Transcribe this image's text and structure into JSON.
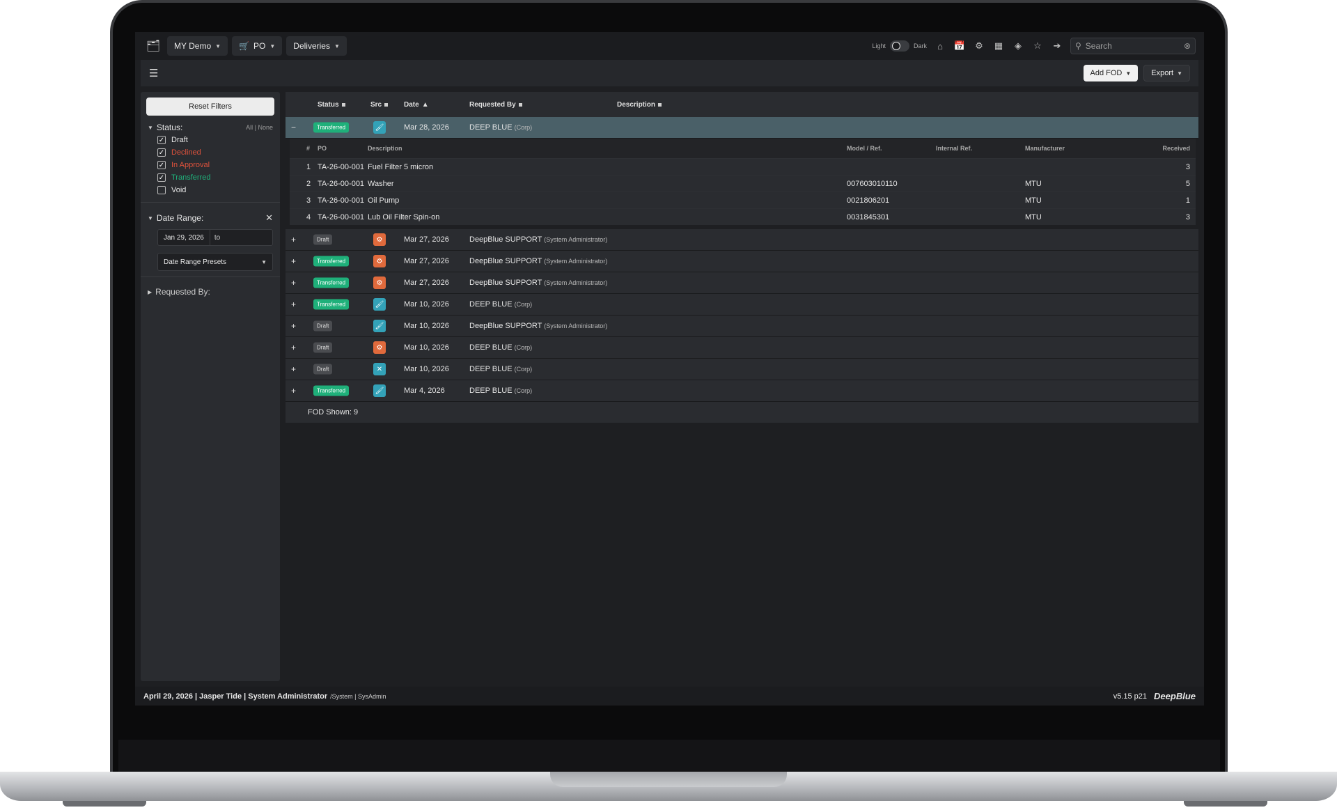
{
  "nav": {
    "menus": [
      {
        "label": "MY Demo"
      },
      {
        "label": "PO"
      },
      {
        "label": "Deliveries"
      }
    ],
    "theme_light": "Light",
    "theme_dark": "Dark",
    "search_placeholder": "Search"
  },
  "toolbar": {
    "add_label": "Add FOD",
    "export_label": "Export"
  },
  "sidebar": {
    "reset_label": "Reset Filters",
    "status_title": "Status:",
    "all_none": "All | None",
    "statuses": [
      {
        "label": "Draft",
        "checked": true,
        "color": "#e6e6e6"
      },
      {
        "label": "Declined",
        "checked": true,
        "color": "#e0523c"
      },
      {
        "label": "In Approval",
        "checked": true,
        "color": "#e0523c"
      },
      {
        "label": "Transferred",
        "checked": true,
        "color": "#1fb07a"
      },
      {
        "label": "Void",
        "checked": false,
        "color": "#e6e6e6"
      }
    ],
    "date_title": "Date Range:",
    "date_from": "Jan 29, 2026",
    "date_to_label": "to",
    "presets_label": "Date Range Presets",
    "requested_title": "Requested By:"
  },
  "table": {
    "headers": {
      "status": "Status",
      "src": "Src",
      "date": "Date",
      "requested_by": "Requested By",
      "description": "Description"
    },
    "rows": [
      {
        "exp": "−",
        "status": "Transferred",
        "src": "blue",
        "date": "Mar 28, 2026",
        "req": "DEEP BLUE",
        "req_sub": "(Corp)",
        "selected": true
      },
      {
        "exp": "+",
        "status": "Draft",
        "src": "orange",
        "date": "Mar 27, 2026",
        "req": "DeepBlue SUPPORT",
        "req_sub": "(System Administrator)"
      },
      {
        "exp": "+",
        "status": "Transferred",
        "src": "orange",
        "date": "Mar 27, 2026",
        "req": "DeepBlue SUPPORT",
        "req_sub": "(System Administrator)"
      },
      {
        "exp": "+",
        "status": "Transferred",
        "src": "orange",
        "date": "Mar 27, 2026",
        "req": "DeepBlue SUPPORT",
        "req_sub": "(System Administrator)"
      },
      {
        "exp": "+",
        "status": "Transferred",
        "src": "blue",
        "date": "Mar 10, 2026",
        "req": "DEEP BLUE",
        "req_sub": "(Corp)"
      },
      {
        "exp": "+",
        "status": "Draft",
        "src": "blue",
        "date": "Mar 10, 2026",
        "req": "DeepBlue SUPPORT",
        "req_sub": "(System Administrator)"
      },
      {
        "exp": "+",
        "status": "Draft",
        "src": "orange",
        "date": "Mar 10, 2026",
        "req": "DEEP BLUE",
        "req_sub": "(Corp)"
      },
      {
        "exp": "+",
        "status": "Draft",
        "src": "blue-tools",
        "date": "Mar 10, 2026",
        "req": "DEEP BLUE",
        "req_sub": "(Corp)"
      },
      {
        "exp": "+",
        "status": "Transferred",
        "src": "blue",
        "date": "Mar 4, 2026",
        "req": "DEEP BLUE",
        "req_sub": "(Corp)"
      }
    ],
    "detail": {
      "headers": {
        "num": "#",
        "po": "PO",
        "description": "Description",
        "model": "Model / Ref.",
        "internal": "Internal Ref.",
        "manufacturer": "Manufacturer",
        "received": "Received"
      },
      "rows": [
        {
          "num": "1",
          "po": "TA-26-00-001",
          "description": "Fuel Filter 5 micron",
          "model": "",
          "manufacturer": "",
          "received": "3"
        },
        {
          "num": "2",
          "po": "TA-26-00-001",
          "description": "Washer",
          "model": "007603010110",
          "manufacturer": "MTU",
          "received": "5"
        },
        {
          "num": "3",
          "po": "TA-26-00-001",
          "description": "Oil Pump",
          "model": "0021806201",
          "manufacturer": "MTU",
          "received": "1"
        },
        {
          "num": "4",
          "po": "TA-26-00-001",
          "description": "Lub Oil Filter Spin-on",
          "model": "0031845301",
          "manufacturer": "MTU",
          "received": "3"
        }
      ]
    },
    "footer": "FOD Shown: 9"
  },
  "footer": {
    "info": "April 29, 2026 | Jasper Tide | System Administrator",
    "info_small": "/System | SysAdmin",
    "version": "v5.15 p21",
    "brand": "DeepBlue"
  }
}
